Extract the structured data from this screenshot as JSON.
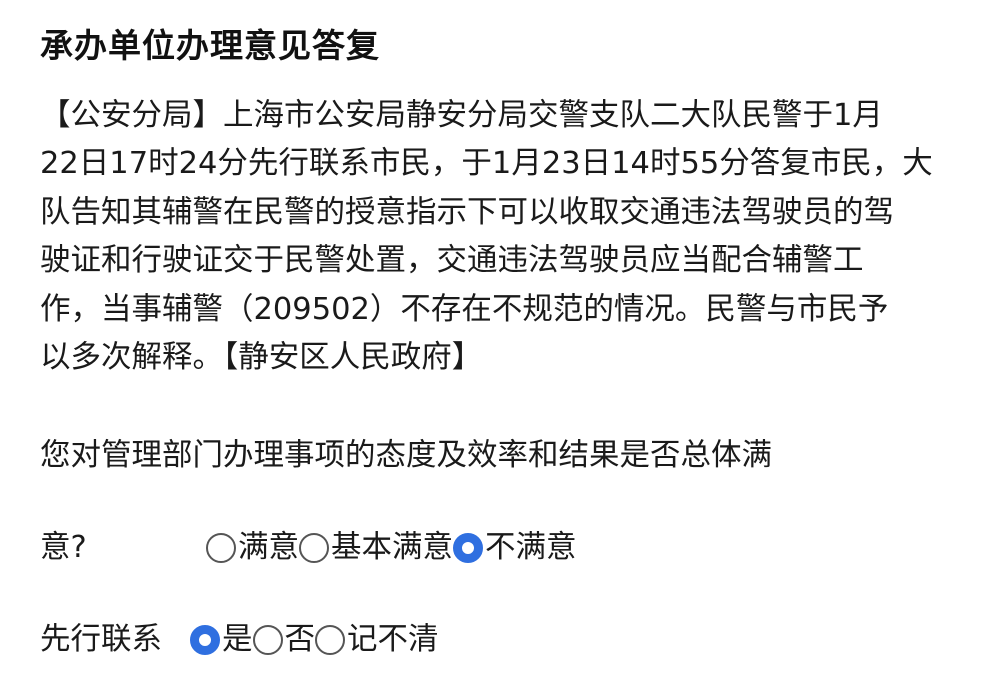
{
  "title": "承办单位办理意见答复",
  "reply_lines": [
    "【公安分局】上海市公安局静安分局交警支队二大队民警于1月",
    "22日17时24分先行联系市民，于1月23日14时55分答复市民，大",
    "队告知其辅警在民警的授意指示下可以收取交通违法驾驶员的驾",
    "驶证和行驶证交于民警处置，交通违法驾驶员应当配合辅警工",
    "作，当事辅警（209502）不存在不规范的情况。民警与市民予",
    "以多次解释。【静安区人民政府】"
  ],
  "satisfaction": {
    "question": "您对管理部门办理事项的态度及效率和结果是否总体满",
    "question_tail": "意?",
    "options": [
      {
        "label": "满意",
        "checked": false
      },
      {
        "label": "基本满意",
        "checked": false
      },
      {
        "label": "不满意",
        "checked": true
      }
    ]
  },
  "contact_first": {
    "label": "先行联系",
    "options": [
      {
        "label": "是",
        "checked": true
      },
      {
        "label": "否",
        "checked": false
      },
      {
        "label": "记不清",
        "checked": false
      }
    ]
  },
  "colors": {
    "accent": "#2f6fe0",
    "text": "#1a1a1a",
    "background": "#ffffff"
  }
}
